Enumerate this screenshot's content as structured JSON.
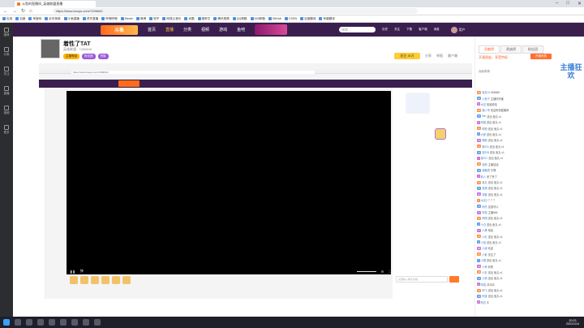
{
  "browser": {
    "tab_title": "斗鱼的直播间_英雄联盟直播",
    "url": "https://www.douyu.com/7496640",
    "bookmarks": [
      "应用",
      "百度",
      "淘宝网",
      "京东商城",
      "斗鱼直播",
      "虎牙直播",
      "哔哩哔哩",
      "Steam",
      "微博",
      "知乎",
      "网易云音乐",
      "优酷",
      "爱奇艺",
      "腾讯视频",
      "QQ邮箱",
      "163邮箱",
      "GitHub",
      "CSDN",
      "百度翻译",
      "有道翻译"
    ]
  },
  "site_nav": [
    "推荐",
    "分类",
    "关注",
    "直播",
    "视频",
    "更多"
  ],
  "site_header": {
    "logo": "斗鱼",
    "nav": [
      "首页",
      "直播",
      "分类",
      "视频",
      "游戏",
      "鱼吧"
    ],
    "search_placeholder": "搜索",
    "icons": [
      "历史",
      "关注",
      "下载",
      "客户端",
      "消息"
    ],
    "username": "用户"
  },
  "streamer": {
    "name": "着性了TAT",
    "subtitle": "英雄联盟 · 7496640",
    "tags": [
      "主播等级",
      "粉丝团",
      "贵族"
    ],
    "follow_label": "关注 30万",
    "buttons": [
      "分享",
      "举报",
      "客户端"
    ]
  },
  "player": {
    "inner_url": "https://www.douyu.com/7496640",
    "controls": [
      "暂停",
      "弹幕",
      "音量",
      "设置",
      "全屏"
    ],
    "input_placeholder": "这里输入聊天内容"
  },
  "right_panel": {
    "tabs": [
      "贡献榜",
      "贵族榜",
      "粉丝团"
    ],
    "vip_text": "开通贵族，享受特权",
    "vip_button": "开通贵族",
    "sub_text": "贡献周榜",
    "event_logo": "主播狂欢",
    "chat": [
      {
        "badge": "30",
        "name": "鱼友01",
        "text": "666666"
      },
      {
        "badge": "12",
        "name": "小鱼干",
        "text": "主播好厉害"
      },
      {
        "badge": "8",
        "name": "水友",
        "text": "哈哈哈哈"
      },
      {
        "badge": "25",
        "name": "路人甲",
        "text": "欢迎来到直播间"
      },
      {
        "badge": "16",
        "name": "fish",
        "text": "送出 鱼丸 x1"
      },
      {
        "badge": "9",
        "name": "阿猫",
        "text": "送出 鱼丸 x1"
      },
      {
        "badge": "21",
        "name": "阿狗",
        "text": "送出 鱼丸 x1"
      },
      {
        "badge": "5",
        "name": "大佬",
        "text": "送出 鱼丸 x1"
      },
      {
        "badge": "18",
        "name": "萌新",
        "text": "送出 鱼丸 x1"
      },
      {
        "badge": "11",
        "name": "观众A",
        "text": "送出 鱼丸 x1"
      },
      {
        "badge": "14",
        "name": "观众B",
        "text": "送出 鱼丸 x1"
      },
      {
        "badge": "7",
        "name": "观众C",
        "text": "送出 鱼丸 x1"
      },
      {
        "badge": "30",
        "name": "老粉",
        "text": "主播加油"
      },
      {
        "badge": "22",
        "name": "弹幕君",
        "text": "牛啊"
      },
      {
        "badge": "3",
        "name": "新人",
        "text": "来了来了"
      },
      {
        "badge": "19",
        "name": "鱼丸",
        "text": "送出 鱼丸 x1"
      },
      {
        "badge": "27",
        "name": "鱼翅",
        "text": "送出 鱼丸 x1"
      },
      {
        "badge": "10",
        "name": "游客",
        "text": "送出 鱼丸 x1"
      },
      {
        "badge": "6",
        "name": "水友2",
        "text": "？？？"
      },
      {
        "badge": "15",
        "name": "阿杰",
        "text": "这波可以"
      },
      {
        "badge": "13",
        "name": "阿伟",
        "text": "主播666"
      },
      {
        "badge": "24",
        "name": "阿明",
        "text": "送出 鱼丸 x1"
      },
      {
        "badge": "2",
        "name": "小白",
        "text": "送出 鱼丸 x1"
      },
      {
        "badge": "17",
        "name": "小黑",
        "text": "哈哈"
      },
      {
        "badge": "20",
        "name": "小红",
        "text": "送出 鱼丸 x1"
      },
      {
        "badge": "4",
        "name": "小蓝",
        "text": "送出 鱼丸 x1"
      },
      {
        "badge": "28",
        "name": "小绿",
        "text": "欢迎"
      },
      {
        "badge": "26",
        "name": "小紫",
        "text": "关注了"
      },
      {
        "badge": "1",
        "name": "小橙",
        "text": "送出 鱼丸 x1"
      },
      {
        "badge": "23",
        "name": "小黄",
        "text": "好看"
      },
      {
        "badge": "29",
        "name": "小灰",
        "text": "送出 鱼丸 x1"
      },
      {
        "badge": "12",
        "name": "小粉",
        "text": "送出 鱼丸 x1"
      },
      {
        "badge": "9",
        "name": "阿强",
        "text": "冲冲冲"
      },
      {
        "badge": "31",
        "name": "阿飞",
        "text": "送出 鱼丸 x1"
      },
      {
        "badge": "18",
        "name": "阿宝",
        "text": "送出 鱼丸 x1"
      },
      {
        "badge": "8",
        "name": "阿亮",
        "text": "牛"
      }
    ]
  },
  "taskbar": {
    "time": "20:23",
    "date": "2021/1/14"
  }
}
